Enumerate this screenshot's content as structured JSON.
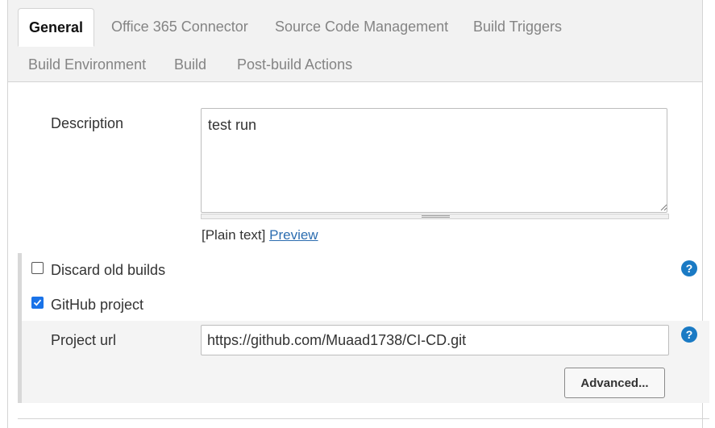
{
  "tabs": [
    {
      "label": "General",
      "active": true
    },
    {
      "label": "Office 365 Connector",
      "active": false
    },
    {
      "label": "Source Code Management",
      "active": false
    },
    {
      "label": "Build Triggers",
      "active": false
    },
    {
      "label": "Build Environment",
      "active": false
    },
    {
      "label": "Build",
      "active": false
    },
    {
      "label": "Post-build Actions",
      "active": false
    }
  ],
  "description": {
    "label": "Description",
    "value": "test run",
    "format_prefix": "[Plain text]",
    "preview_link": "Preview"
  },
  "options": {
    "discard_old_builds": {
      "label": "Discard old builds",
      "checked": false
    },
    "github_project": {
      "label": "GitHub project",
      "checked": true
    }
  },
  "project_url": {
    "label": "Project url",
    "value": "https://github.com/Muaad1738/CI-CD.git"
  },
  "advanced_button": "Advanced...",
  "help_icon_glyph": "?",
  "colors": {
    "accent": "#1a73e8",
    "help": "#1a7ac4",
    "link": "#2c6db0",
    "tab_inactive": "#848484"
  }
}
